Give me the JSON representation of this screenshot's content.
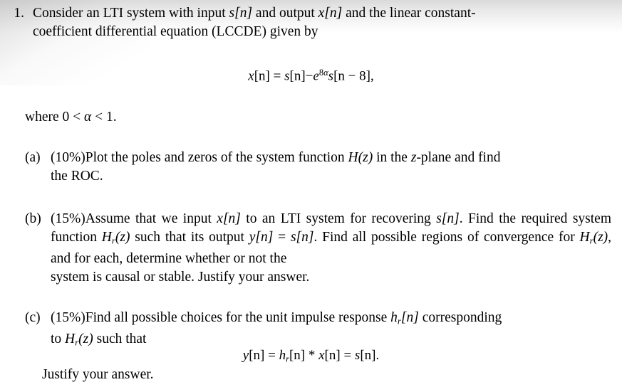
{
  "document": {
    "type": "exam-question",
    "question_number": "1.",
    "intro": {
      "line1_pre": "Consider an LTI system with input ",
      "var_s": "s[n]",
      "line1_mid": " and output ",
      "var_x": "x[n]",
      "line1_post": " and the linear constant-",
      "line2": "coefficient differential equation (LCCDE) given by"
    },
    "main_equation": {
      "lhs_var": "x",
      "lhs_index": "[n]",
      "equals": "=",
      "term1_var": "s",
      "term1_index": "[n]",
      "minus": "−",
      "exp_base": "e",
      "exp_power_num": "8",
      "exp_power_sym": "α",
      "term2_var": "s",
      "term2_index": "[n − 8]",
      "trailing": ","
    },
    "where_clause": {
      "word": "where",
      "condition_lo": "0 < ",
      "alpha": "α",
      "condition_hi": " < 1",
      "period": "."
    },
    "parts": [
      {
        "label": "(a)",
        "weight": "(10%)",
        "text_pre": "Plot the poles and zeros of the system function ",
        "func": "H(z)",
        "text_mid": " in the ",
        "plane_var": "z",
        "text_post": "-plane and find",
        "line2": "the ROC."
      },
      {
        "label": "(b)",
        "weight": "(15%)",
        "line1_pre": "Assume that we input ",
        "var_x": "x[n]",
        "line1_mid": " to an LTI system for recovering ",
        "var_s": "s[n]",
        "line1_post": ". Find the",
        "line2_pre": "required system function ",
        "func_hr": "H",
        "func_hr_sub": "r",
        "func_hr_arg": "(z)",
        "line2_mid": " such that its output ",
        "var_y": "y[n]",
        "eq_sign": " = ",
        "var_s2": "s[n]",
        "line2_post": ". Find all possible",
        "line3_pre": "regions of convergence for ",
        "func_hr2": "H",
        "func_hr2_sub": "r",
        "func_hr2_arg": "(z)",
        "line3_post": ", and for each, determine whether or not the",
        "line4": "system is causal or stable. Justify your answer."
      },
      {
        "label": "(c)",
        "weight": "(15%)",
        "line1_pre": "Find all possible choices for the unit impulse response ",
        "var_hr": "h",
        "var_hr_sub": "r",
        "var_hr_idx": "[n]",
        "line1_post": " corresponding",
        "line2_pre": "to ",
        "func_hr": "H",
        "func_hr_sub": "r",
        "func_hr_arg": "(z)",
        "line2_post": " such that"
      }
    ],
    "equation_c": {
      "lhs_var": "y",
      "lhs_index": "[n]",
      "equals1": "=",
      "h_var": "h",
      "h_sub": "r",
      "h_index": "[n]",
      "conv": "*",
      "x_var": "x",
      "x_index": "[n]",
      "equals2": "=",
      "s_var": "s",
      "s_index": "[n]",
      "period": "."
    },
    "closing_line": "Justify your answer."
  }
}
